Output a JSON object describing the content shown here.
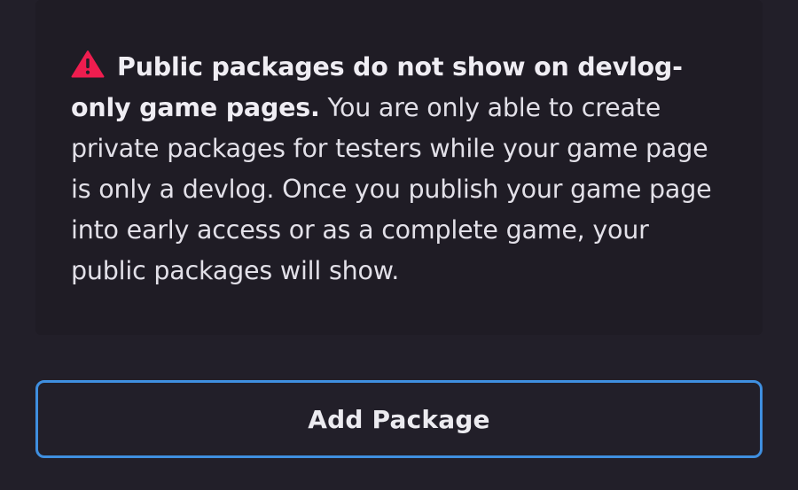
{
  "notice": {
    "icon": "warning-triangle-icon",
    "icon_color": "#ef1d4f",
    "bold_text": "Public packages do not show on devlog-only game pages.",
    "body_text": " You are only able to create private packages for testers while your game page is only a devlog. Once you publish your game page into early access or as a complete game, your public packages will show."
  },
  "actions": {
    "add_package_label": "Add Package"
  },
  "colors": {
    "background": "#221f29",
    "panel": "#1f1c25",
    "accent_border": "#3f8fe0",
    "text": "#e2e0e8"
  }
}
